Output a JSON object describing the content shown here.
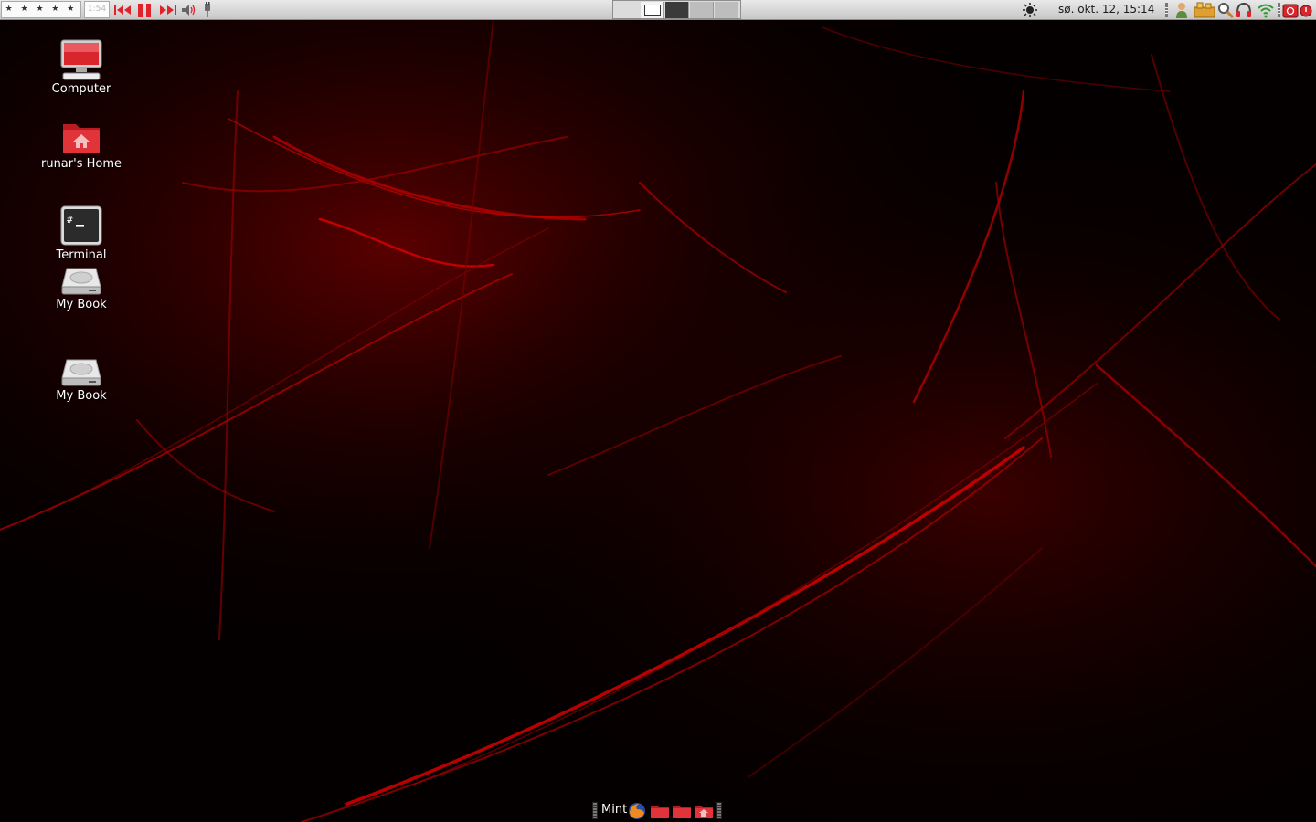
{
  "top_panel": {
    "rating": "★ ★ ★ ★ ★",
    "elapsed": "1:54",
    "clock": "sø. okt. 12, 15:14",
    "workspaces": [
      "1",
      "2",
      "3",
      "4"
    ],
    "active_workspace": 1
  },
  "desktop": {
    "icons": [
      {
        "label": "Computer"
      },
      {
        "label": "runar's Home"
      },
      {
        "label": "Terminal"
      },
      {
        "label": "My Book"
      },
      {
        "label": "My Book"
      }
    ]
  },
  "dock": {
    "menu_label": "Mint"
  },
  "colors": {
    "accent": "#e0232a",
    "panel": "#d8d8d8",
    "wallpaper": "#050000"
  },
  "icons": {
    "media": [
      "previous-icon",
      "pause-icon",
      "next-icon",
      "volume-icon"
    ],
    "tray": [
      "brightness-icon",
      "user-icon",
      "package-icon",
      "search-icon",
      "headphones-icon",
      "wifi-icon",
      "shutdown-icon"
    ]
  }
}
